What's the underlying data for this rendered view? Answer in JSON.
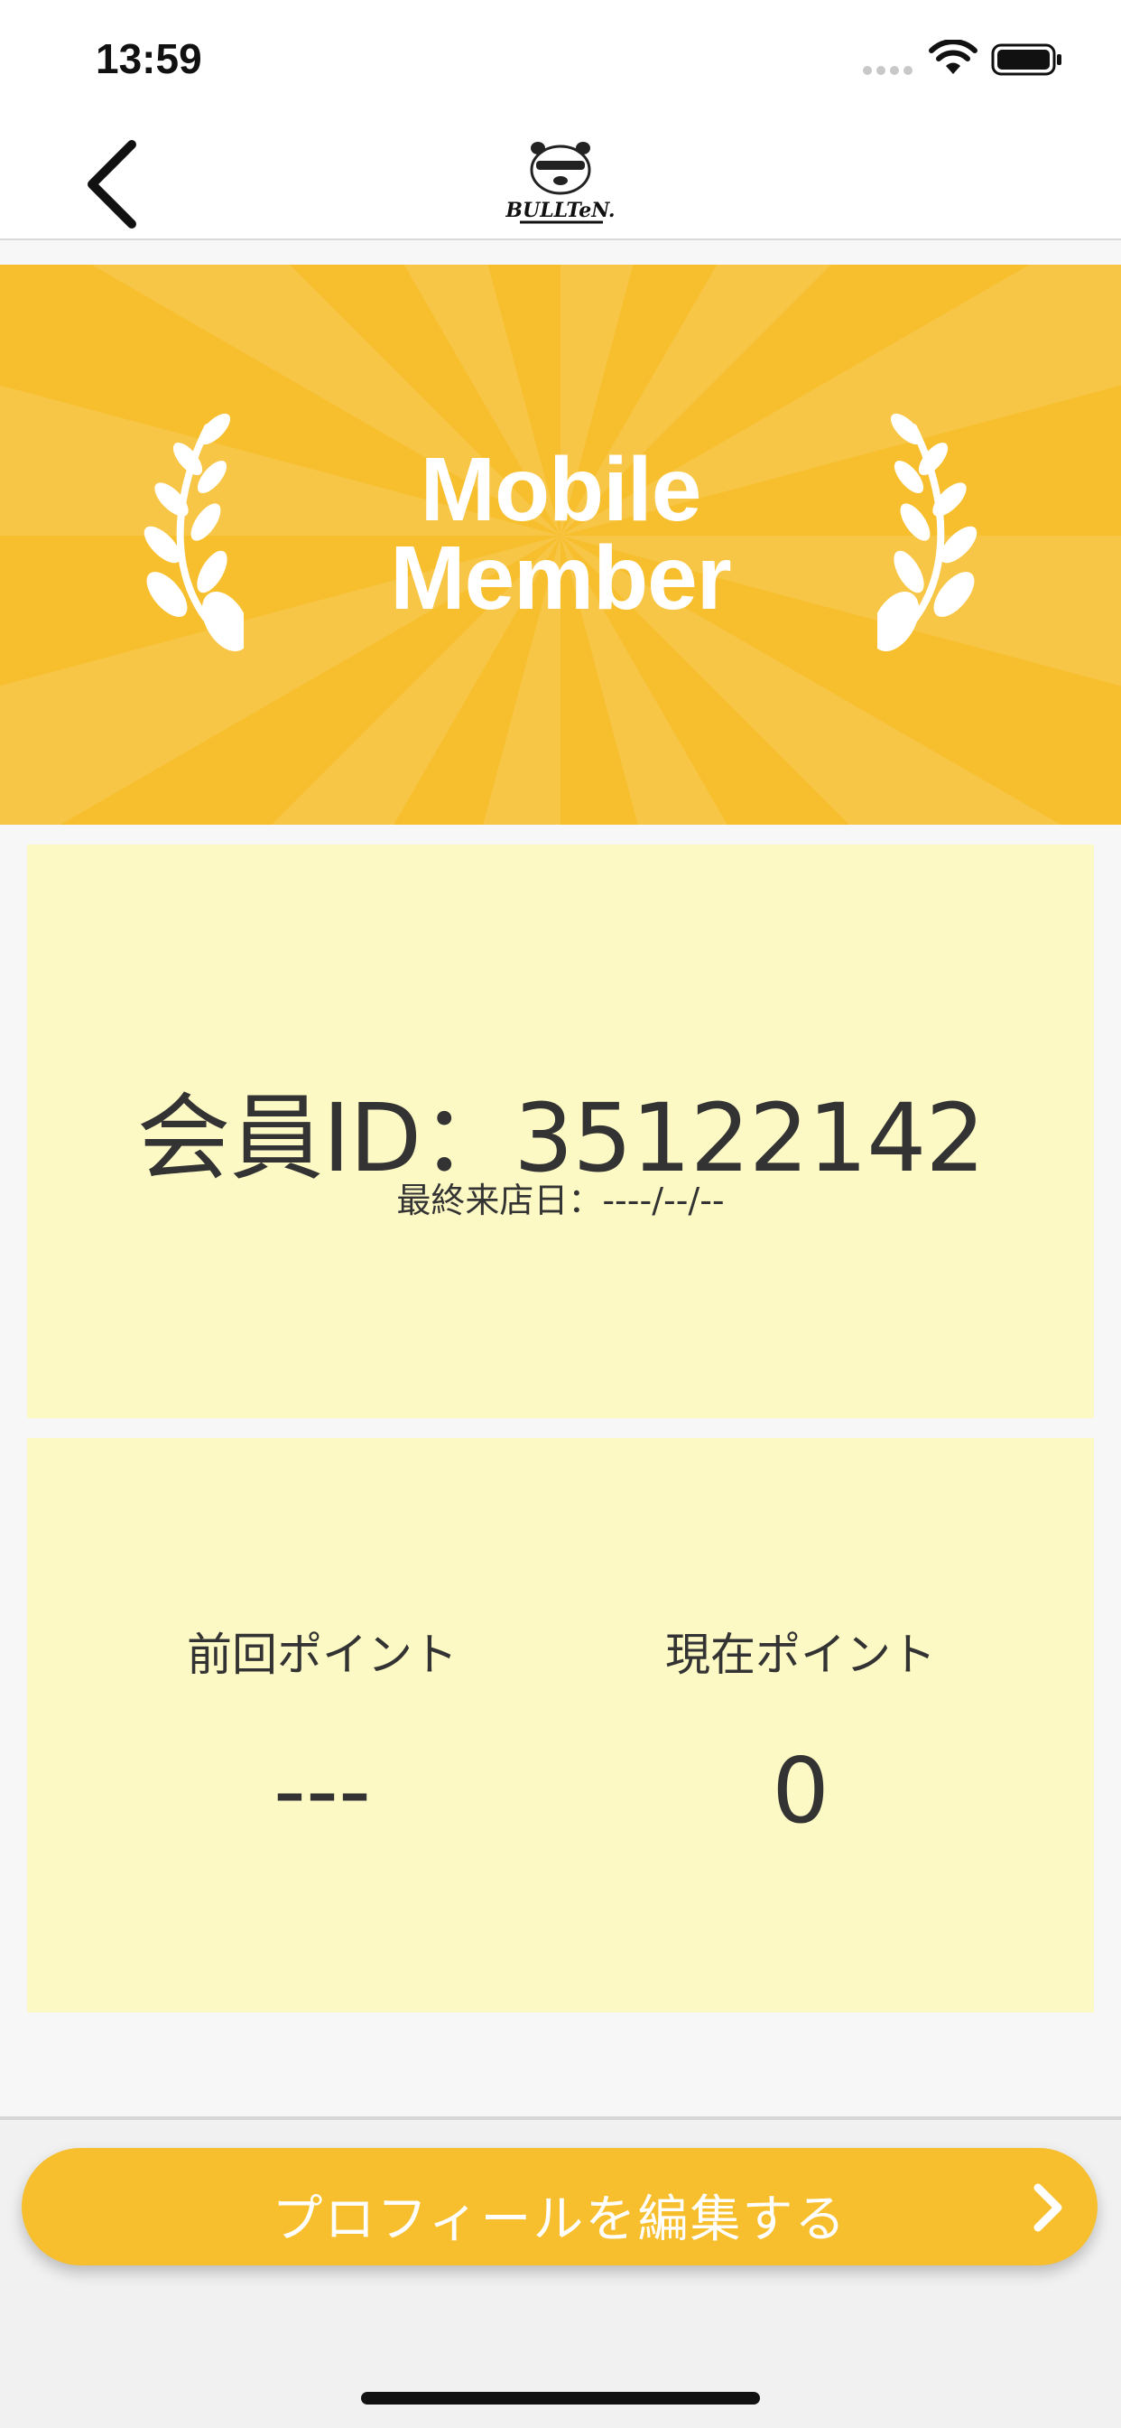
{
  "status_bar": {
    "time": "13:59",
    "icons": [
      "signal-icon",
      "wifi-icon",
      "battery-icon"
    ]
  },
  "nav": {
    "back_icon": "chevron-left-icon",
    "logo_text": "BULLTeN."
  },
  "banner": {
    "title_line1": "Mobile",
    "title_line2": "Member",
    "background_color": "#f7bf2e",
    "decoration": [
      "laurel-left-icon",
      "laurel-right-icon"
    ]
  },
  "member_card": {
    "member_id_text": "会員ID：35122142",
    "last_visit_text": "最終来店日：----/--/--",
    "background_color": "#fdf9c4"
  },
  "points_card": {
    "previous_label": "前回ポイント",
    "previous_value": "---",
    "current_label": "現在ポイント",
    "current_value": "0"
  },
  "actions": {
    "edit_profile_label": "プロフィールを編集する",
    "edit_profile_icon": "chevron-right-icon",
    "button_color": "#f7bf2e"
  }
}
